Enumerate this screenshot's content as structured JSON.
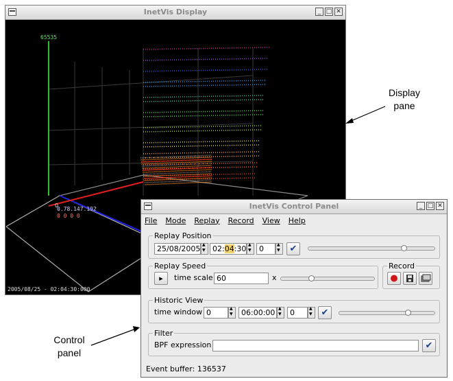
{
  "display_window": {
    "title": "InetVis Display",
    "timestamp": "2005/08/25 - 02:04:30:000",
    "y_axis_max": "65535",
    "origin_zero": "0",
    "origin_ip": "0 0 0 0",
    "origin_ip_label": "0.78.147.192"
  },
  "control_window": {
    "title": "InetVis Control Panel",
    "menu": [
      "File",
      "Mode",
      "Replay",
      "Record",
      "View",
      "Help"
    ],
    "replay_position": {
      "label": "Replay Position",
      "date": "25/08/2005",
      "time_prefix": "02:",
      "time_highlight": "04",
      "time_suffix": ":30",
      "offset": "0",
      "slider_level": 0.76
    },
    "replay_speed": {
      "label": "Replay Speed",
      "play_icon": "play-icon",
      "scale_label": "time scale",
      "scale_value": "60",
      "multiplier": "x",
      "slider_level": 0.33
    },
    "record": {
      "label": "Record",
      "icons": [
        "record-icon",
        "save-icon",
        "snapshot-icon"
      ]
    },
    "historic_view": {
      "label": "Historic View",
      "window_label": "time window",
      "days": "0",
      "time": "06:00:00",
      "offset": "0",
      "slider_level": 0.73
    },
    "filter": {
      "label": "Filter",
      "bpf_label": "BPF expression",
      "bpf_value": ""
    },
    "status": "Event buffer: 136537"
  },
  "annotations": {
    "display_line1": "Display",
    "display_line2": "pane",
    "control_line1": "Control",
    "control_line2": "panel"
  },
  "colors": {
    "x_axis": "#e02020",
    "y_axis": "#30c030",
    "z_axis": "#2020e0",
    "highlight": "#f5d36c",
    "check": "#1a3f8c"
  }
}
